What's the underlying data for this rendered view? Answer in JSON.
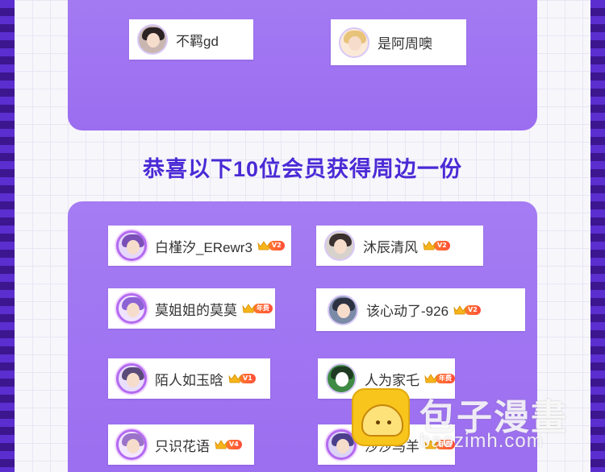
{
  "headline": "恭喜以下10位会员获得周边一份",
  "top_winners": [
    {
      "nickname": "不羁gd",
      "avatar": "user-avatar-icon"
    },
    {
      "nickname": "是阿周噢",
      "avatar": "user-avatar-icon"
    }
  ],
  "winners": [
    {
      "nickname": "白槿汐_ERewr3",
      "badge": "V2"
    },
    {
      "nickname": "沐辰清风",
      "badge": "V2"
    },
    {
      "nickname": "莫姐姐的莫莫",
      "badge": "年费"
    },
    {
      "nickname": "该心动了-926",
      "badge": "V2"
    },
    {
      "nickname": "陌人如玉晗",
      "badge": "V1"
    },
    {
      "nickname": "人为家乇",
      "badge": "年费"
    },
    {
      "nickname": "只识花语",
      "badge": "V4"
    },
    {
      "nickname": "沙沙马羊",
      "badge": "年费"
    }
  ],
  "watermark": {
    "title": "包子漫畫",
    "url": "baozimh.com"
  },
  "colors": {
    "panel": "#a57cf3",
    "headline": "#4a2ad6",
    "badge": "#ff5a34",
    "crown": "#f6b51b"
  }
}
